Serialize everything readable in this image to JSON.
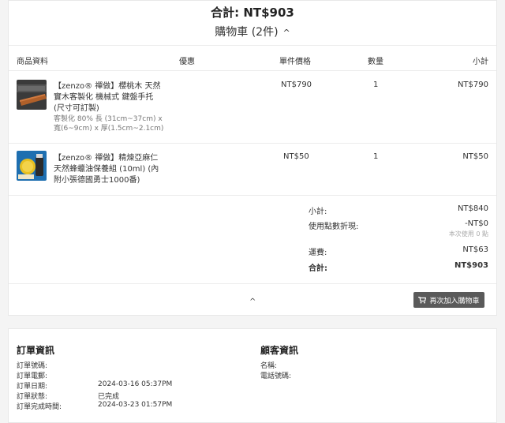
{
  "summary": {
    "total_line": "合計: NT$903",
    "cart_label": "購物車 (2件)",
    "chevron": "^"
  },
  "table": {
    "headers": {
      "product": "商品資料",
      "discount": "優惠",
      "unit_price": "單件價格",
      "quantity": "數量",
      "subtotal": "小計"
    }
  },
  "items": [
    {
      "name": "【zenzo® 禪做】櫻桃木 天然實木客製化 機械式 鍵盤手托 (尺寸可訂製)",
      "variant": "客製化 80% 長 (31cm~37cm) x 寬(6~9cm) x 厚(1.5cm~2.1cm)",
      "unit_price": "NT$790",
      "quantity": "1",
      "subtotal": "NT$790",
      "thumb_icon": "wooden-wrist-rest"
    },
    {
      "name": "【zenzo® 禪做】精煉亞麻仁 天然蜂蠟油保養組 (10ml) (內附小張德國勇士1000番)",
      "variant": "",
      "unit_price": "NT$50",
      "quantity": "1",
      "subtotal": "NT$50",
      "thumb_icon": "beeswax-oil-kit"
    }
  ],
  "totals": {
    "subtotal_label": "小計:",
    "subtotal_value": "NT$840",
    "points_label": "使用點數折現:",
    "points_value": "-NT$0",
    "points_note": "本次使用 0 點",
    "shipping_label": "運費:",
    "shipping_value": "NT$63",
    "total_label": "合計:",
    "total_value": "NT$903"
  },
  "actions": {
    "collapse_chevron": "^",
    "reorder_label": "再次加入購物車",
    "reorder_icon": "cart-icon"
  },
  "order_info": {
    "title": "訂單資訊",
    "rows": [
      {
        "label": "訂單號碼:",
        "value": ""
      },
      {
        "label": "訂單電郵:",
        "value": ""
      },
      {
        "label": "訂單日期:",
        "value": "2024-03-16 05:37PM"
      },
      {
        "label": "訂單狀態:",
        "value": "已完成"
      },
      {
        "label": "訂單完成時間:",
        "value": "2024-03-23 01:57PM"
      }
    ]
  },
  "customer_info": {
    "title": "顧客資訊",
    "rows": [
      {
        "label": "名稱:",
        "value": ""
      },
      {
        "label": "電話號碼:",
        "value": ""
      }
    ]
  },
  "colors": {
    "button_bg": "#5a5a5a",
    "border": "#ececec"
  }
}
